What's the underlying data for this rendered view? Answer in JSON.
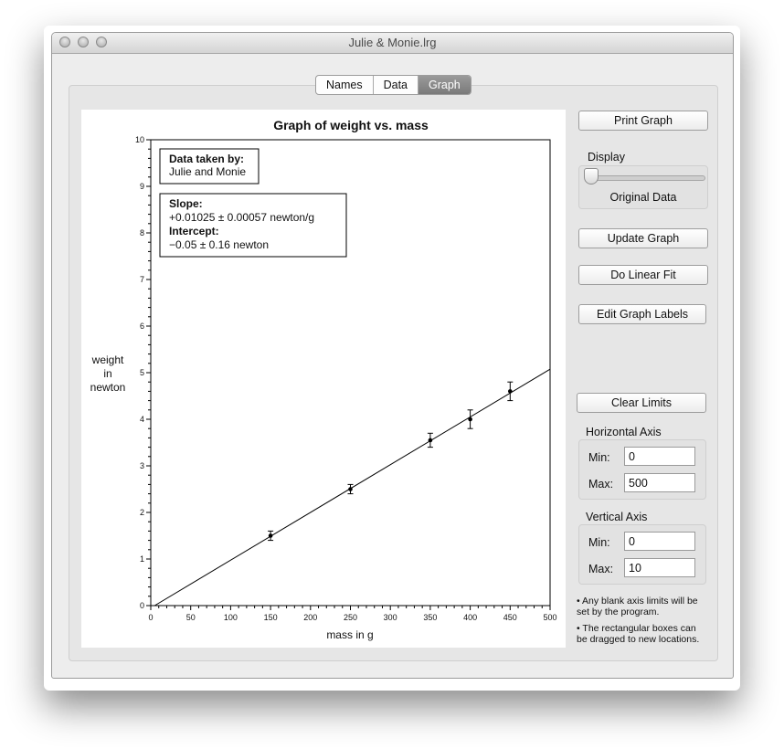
{
  "window": {
    "title": "Julie & Monie.lrg"
  },
  "tabs": [
    "Names",
    "Data",
    "Graph"
  ],
  "active_tab": "Graph",
  "graph": {
    "title": "Graph of weight vs. mass",
    "ylabel_lines": [
      "weight",
      "in",
      "newton"
    ],
    "xlabel": "mass in g",
    "data_box": {
      "heading": "Data taken by:",
      "text": "Julie and Monie"
    },
    "fit_box": {
      "slope_heading": "Slope:",
      "slope_value": "+0.01025 ± 0.00057 newton/g",
      "intercept_heading": "Intercept:",
      "intercept_value": "−0.05 ± 0.16 newton"
    }
  },
  "chart_data": {
    "type": "scatter",
    "title": "Graph of weight vs. mass",
    "xlabel": "mass in g",
    "ylabel": "weight in newton",
    "xlim": [
      0,
      500
    ],
    "ylim": [
      0,
      10
    ],
    "xticks": [
      "0",
      "50",
      "100",
      "150",
      "200",
      "250",
      "300",
      "350",
      "400",
      "450",
      "500"
    ],
    "yticks": [
      "0",
      "1",
      "2",
      "3",
      "4",
      "5",
      "6",
      "7",
      "8",
      "9",
      "10"
    ],
    "points": [
      {
        "x": 150,
        "y": 1.5,
        "err": 0.1
      },
      {
        "x": 250,
        "y": 2.5,
        "err": 0.1
      },
      {
        "x": 350,
        "y": 3.55,
        "err": 0.15
      },
      {
        "x": 400,
        "y": 4.0,
        "err": 0.2
      },
      {
        "x": 450,
        "y": 4.6,
        "err": 0.2
      }
    ],
    "fit_line": {
      "slope": 0.01025,
      "intercept": -0.05
    },
    "grid": false
  },
  "controls": {
    "print_graph": "Print Graph",
    "display_label": "Display",
    "display_value": "Original Data",
    "update_graph": "Update Graph",
    "do_linear_fit": "Do Linear Fit",
    "edit_graph_labels": "Edit Graph Labels",
    "clear_limits": "Clear Limits",
    "horizontal_axis": {
      "label": "Horizontal Axis",
      "min_label": "Min:",
      "min": "0",
      "max_label": "Max:",
      "max": "500"
    },
    "vertical_axis": {
      "label": "Vertical Axis",
      "min_label": "Min:",
      "min": "0",
      "max_label": "Max:",
      "max": "10"
    },
    "note1": "• Any blank axis limits will be set by the program.",
    "note2": "• The rectangular boxes can be dragged to new locations."
  }
}
